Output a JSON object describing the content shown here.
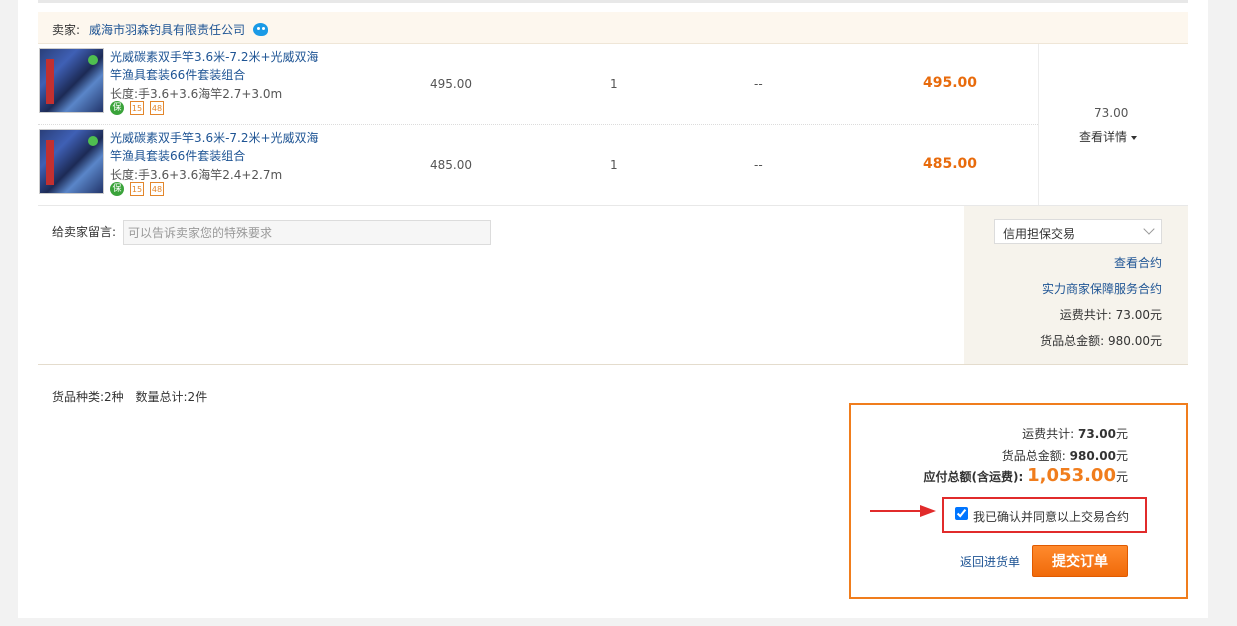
{
  "seller": {
    "label": "卖家:",
    "name": "威海市羽森钓具有限责任公司",
    "chat_icon": "wangwang-chat-icon"
  },
  "items": [
    {
      "title": "光威碳素双手竿3.6米-7.2米+光威双海竿渔具套装66件套装组合",
      "spec": "长度:手3.6+3.6海竿2.7+3.0m",
      "badges": [
        "保",
        "15",
        "48"
      ],
      "unit_price": "495.00",
      "quantity": "1",
      "discount": "--",
      "subtotal": "495.00"
    },
    {
      "title": "光威碳素双手竿3.6米-7.2米+光威双海竿渔具套装66件套装组合",
      "spec": "长度:手3.6+3.6海竿2.4+2.7m",
      "badges": [
        "保",
        "15",
        "48"
      ],
      "unit_price": "485.00",
      "quantity": "1",
      "discount": "--",
      "subtotal": "485.00"
    }
  ],
  "freight": {
    "value": "73.00",
    "detail_label": "查看详情"
  },
  "message": {
    "label": "给卖家留言:",
    "placeholder": "可以告诉卖家您的特殊要求"
  },
  "side": {
    "trade_type": "信用担保交易",
    "view_contract": "查看合约",
    "merchant_contract": "实力商家保障服务合约",
    "freight_total": "运费共计:  73.00元",
    "goods_total": "货品总金额:  980.00元"
  },
  "totals_left": {
    "kinds": "货品种类:2种",
    "count": "数量总计:2件"
  },
  "summary": {
    "freight_label": "运费共计:",
    "freight_value": "73.00",
    "goods_label": "货品总金额:",
    "goods_value": "980.00",
    "payable_label": "应付总额(含运费):",
    "payable_value": "1,053.00",
    "unit": "元",
    "agree_text": "我已确认并同意以上交易合约",
    "agree_checked": true,
    "back_link": "返回进货单",
    "submit_label": "提交订单"
  },
  "colors": {
    "accent_orange": "#f07d1d",
    "price_orange": "#e86b0c",
    "link_blue": "#1e5494",
    "highlight_red": "#e12b2b"
  }
}
